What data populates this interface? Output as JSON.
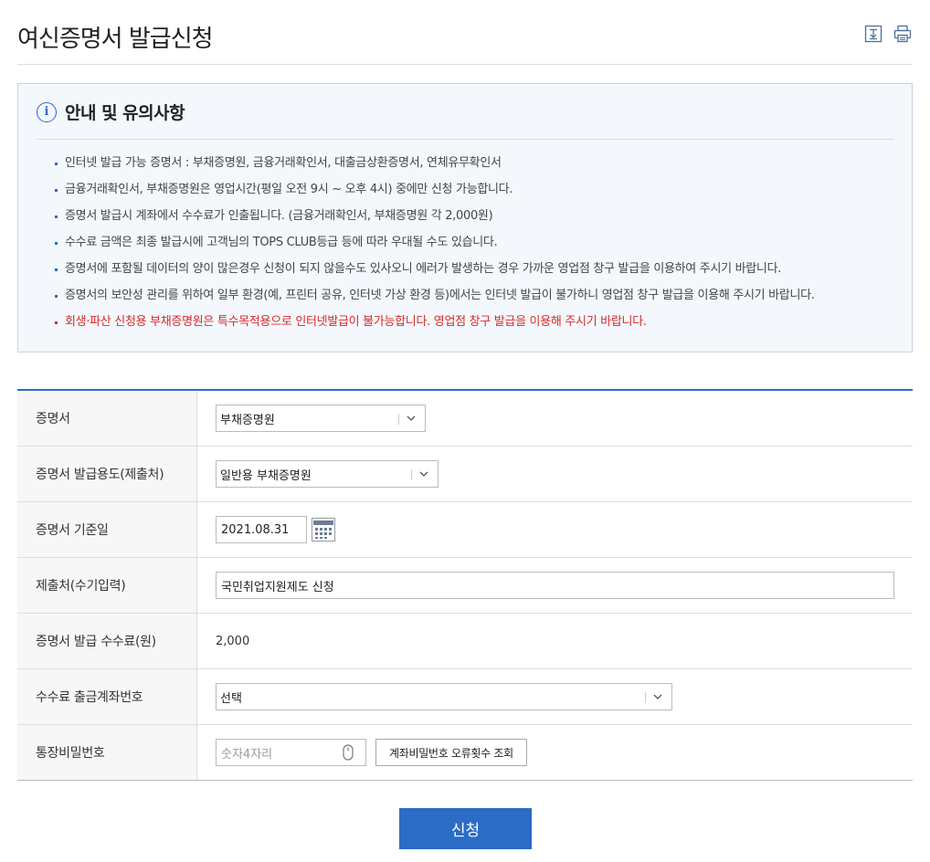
{
  "page": {
    "title": "여신증명서 발급신청",
    "icons": [
      "download-icon",
      "print-icon"
    ]
  },
  "notice": {
    "title": "안내 및 유의사항",
    "icon": "info-icon",
    "items": [
      "인터넷 발급 가능 증명서 : 부채증명원, 금융거래확인서, 대출금상환증명서, 연체유무확인서",
      "금융거래확인서, 부채증명원은 영업시간(평일 오전 9시 ~ 오후 4시) 중에만 신청 가능합니다.",
      "증명서 발급시 계좌에서 수수료가 인출됩니다. (금융거래확인서, 부채증명원 각 2,000원)",
      "수수료 금액은 최종 발급시에 고객님의 TOPS CLUB등급 등에 따라 우대될 수도 있습니다.",
      "증명서에 포함될 데이터의 양이 많은경우 신청이 되지 않을수도 있사오니 에러가 발생하는 경우 가까운 영업점 창구 발급을 이용하여 주시기 바랍니다.",
      "증명서의 보안성 관리를 위하여 일부 환경(예, 프린터 공유, 인터넷 가상 환경 등)에서는 인터넷 발급이 불가하니 영업점 창구 발급을 이용해 주시기 바랍니다."
    ],
    "warning": "회생·파산 신청용 부채증명원은 특수목적용으로 인터넷발급이 불가능합니다. 영업점 창구 발급을 이용해 주시기 바랍니다.",
    "warning_color": "#d62b2b"
  },
  "form": {
    "certificate": {
      "label": "증명서",
      "value": "부채증명원"
    },
    "purpose": {
      "label": "증명서 발급용도(제출처)",
      "value": "일반용 부채증명원"
    },
    "base_date": {
      "label": "증명서 기준일",
      "value": "2021.08.31"
    },
    "recipient": {
      "label": "제출처(수기입력)",
      "value": "국민취업지원제도 신청"
    },
    "fee": {
      "label": "증명서 발급 수수료(원)",
      "value": "2,000"
    },
    "account": {
      "label": "수수료 출금계좌번호",
      "value": "선택"
    },
    "password": {
      "label": "통장비밀번호",
      "placeholder": "숫자4자리",
      "check_button": "계좌비밀번호 오류횟수 조회"
    }
  },
  "submit_label": "신청",
  "accent_color": "#2b6cc4"
}
